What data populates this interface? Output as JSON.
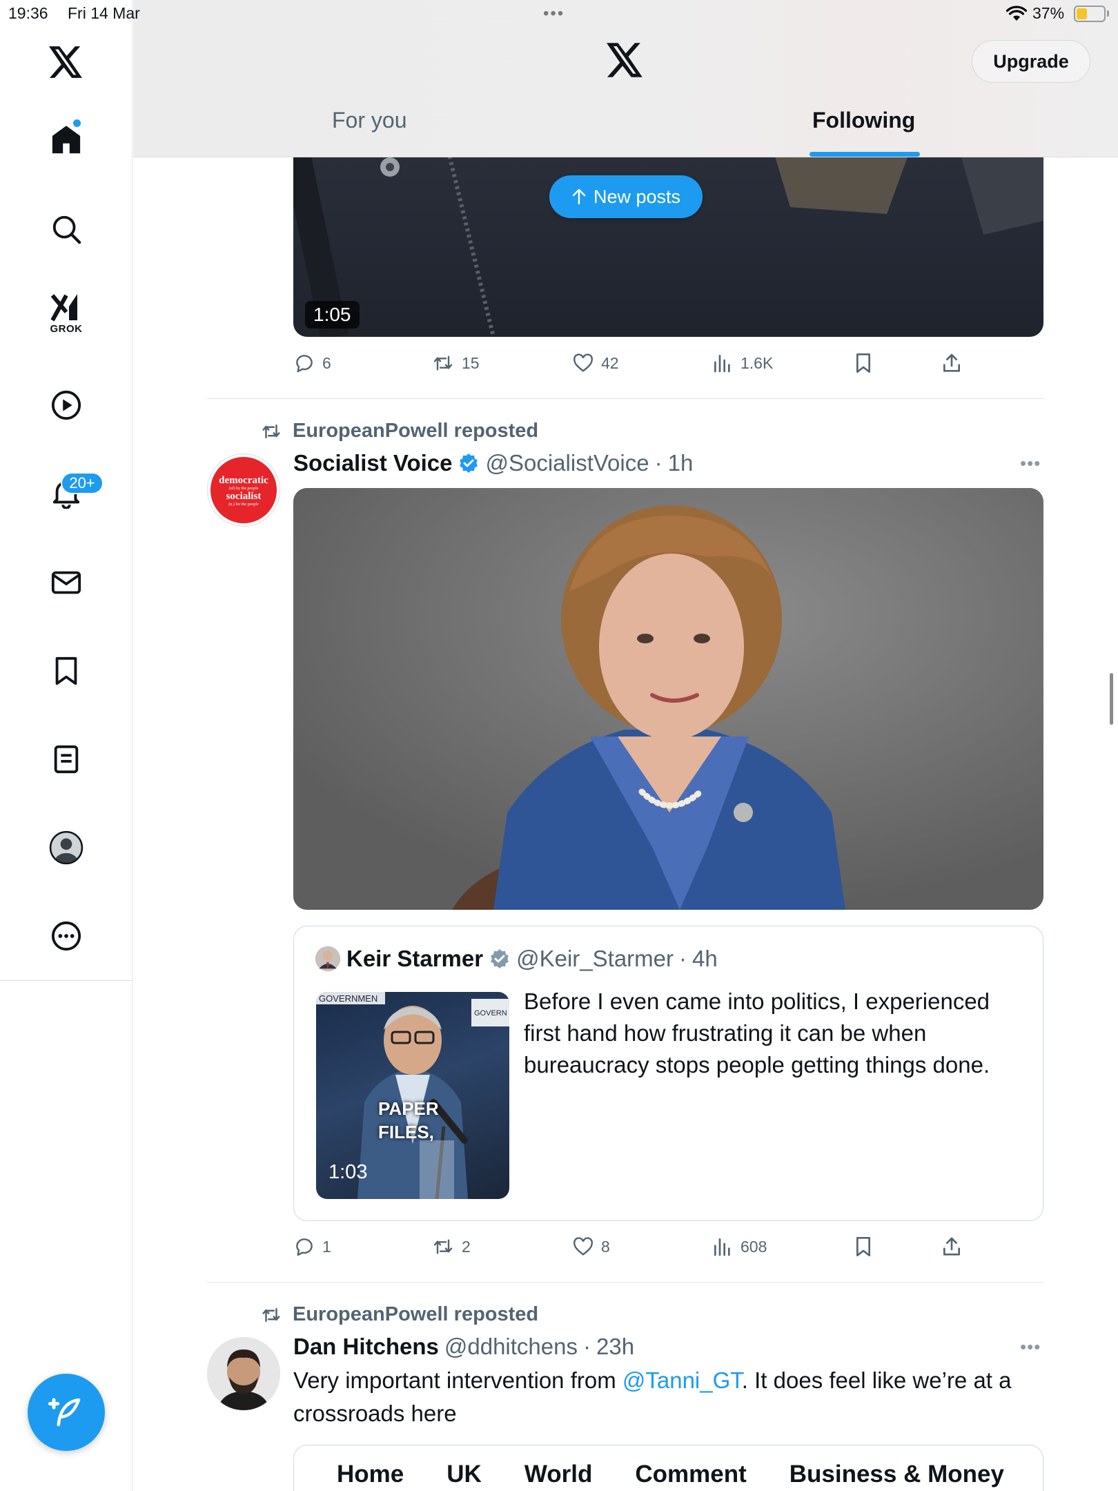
{
  "status_bar": {
    "time": "19:36",
    "date": "Fri 14 Mar",
    "battery": "37%",
    "battery_level": 0.37
  },
  "header": {
    "upgrade_label": "Upgrade",
    "tabs": [
      {
        "label": "For you",
        "active": false
      },
      {
        "label": "Following",
        "active": true
      }
    ]
  },
  "sidebar": {
    "items": [
      {
        "name": "home",
        "icon": "home-icon"
      },
      {
        "name": "search",
        "icon": "search-icon"
      },
      {
        "name": "grok",
        "icon": "grok-icon",
        "label": "GROK"
      },
      {
        "name": "video",
        "icon": "play-icon"
      },
      {
        "name": "notifications",
        "icon": "bell-icon",
        "badge": "20+"
      },
      {
        "name": "messages",
        "icon": "mail-icon"
      },
      {
        "name": "bookmarks",
        "icon": "bookmark-icon"
      },
      {
        "name": "lists",
        "icon": "list-icon"
      },
      {
        "name": "profile",
        "icon": "profile-icon"
      },
      {
        "name": "more",
        "icon": "more-icon"
      }
    ]
  },
  "new_posts_label": "New posts",
  "feed": {
    "video_post": {
      "duration": "1:05",
      "replies": "6",
      "reposts": "15",
      "likes": "42",
      "views": "1.6K"
    },
    "post1": {
      "repost_label": "EuropeanPowell reposted",
      "author_name": "Socialist Voice",
      "verified": true,
      "handle": "@SocialistVoice",
      "time": "1h",
      "avatar_lines": [
        "democratic",
        "(of) by the people",
        "socialist",
        "(n.) for the people"
      ],
      "quote": {
        "author_name": "Keir Starmer",
        "verified": true,
        "handle": "@Keir_Starmer",
        "time": "4h",
        "thumb_duration": "1:03",
        "thumb_caption_line1": "PAPER",
        "thumb_caption_line2": "FILES,",
        "thumb_sign_left": "GOVERNMEN",
        "thumb_sign_right": "GOVERN",
        "text": "Before I even came into politics, I experienced first hand how frustrating it can be when bureaucracy stops people getting things done."
      },
      "replies": "1",
      "reposts": "2",
      "likes": "8",
      "views": "608"
    },
    "post2": {
      "repost_label": "EuropeanPowell reposted",
      "author_name": "Dan Hitchens",
      "handle": "@ddhitchens",
      "time": "23h",
      "text_before": "Very important intervention from ",
      "mention": "@Tanni_GT",
      "text_after": ". It does feel like we’re at a crossroads here",
      "embed_nav": [
        "Home",
        "UK",
        "World",
        "Comment",
        "Business & Money"
      ]
    }
  },
  "colors": {
    "accent": "#1d9bf0",
    "text_primary": "#0f1419",
    "text_secondary": "#536471",
    "avatar_red": "#e5252a"
  }
}
